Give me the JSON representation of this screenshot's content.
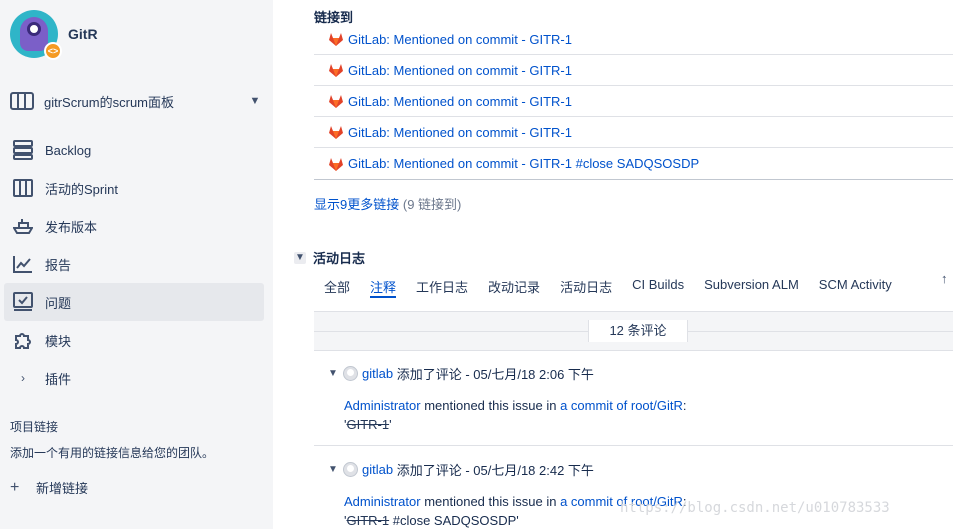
{
  "sidebar": {
    "project_name": "GitR",
    "board_label": "gitrScrum的scrum面板",
    "items": [
      {
        "label": "Backlog",
        "icon": "backlog-icon"
      },
      {
        "label": "活动的Sprint",
        "icon": "board-columns-icon"
      },
      {
        "label": "发布版本",
        "icon": "ship-icon"
      },
      {
        "label": "报告",
        "icon": "chart-line-icon"
      },
      {
        "label": "问题",
        "icon": "issues-icon",
        "selected": true
      },
      {
        "label": "模块",
        "icon": "puzzle-icon"
      },
      {
        "label": "插件",
        "icon": "chevron-right-icon"
      }
    ],
    "section_title": "项目链接",
    "section_desc": "添加一个有用的链接信息给您的团队。",
    "add_link": "新增链接"
  },
  "links": {
    "heading": "链接到",
    "items": [
      "GitLab: Mentioned on commit - GITR-1",
      "GitLab: Mentioned on commit - GITR-1",
      "GitLab: Mentioned on commit - GITR-1",
      "GitLab: Mentioned on commit - GITR-1",
      "GitLab: Mentioned on commit - GITR-1 #close SADQSOSDP"
    ],
    "more_label": "显示9更多链接",
    "more_count": "(9 链接到)"
  },
  "activity": {
    "heading": "活动日志",
    "tabs": [
      "全部",
      "注释",
      "工作日志",
      "改动记录",
      "活动日志",
      "CI Builds",
      "Subversion ALM",
      "SCM Activity"
    ],
    "active_tab": "注释",
    "count_label": "12 条评论",
    "comments": [
      {
        "author": "gitlab",
        "meta": "添加了评论 - 05/七月/18 2:06 下午",
        "user": "Administrator",
        "text": "mentioned this issue in",
        "link": "a commit of root/GitR",
        "colon": ":",
        "issue_struck": "GITR-1",
        "suffix": "'"
      },
      {
        "author": "gitlab",
        "meta": "添加了评论 - 05/七月/18 2:42 下午",
        "user": "Administrator",
        "text": "mentioned this issue in",
        "link": "a commit of root/GitR",
        "colon": ":",
        "issue_struck": "GITR-1",
        "suffix": " #close SADQSOSDP'"
      }
    ]
  },
  "watermark": "https://blog.csdn.net/u010783533"
}
